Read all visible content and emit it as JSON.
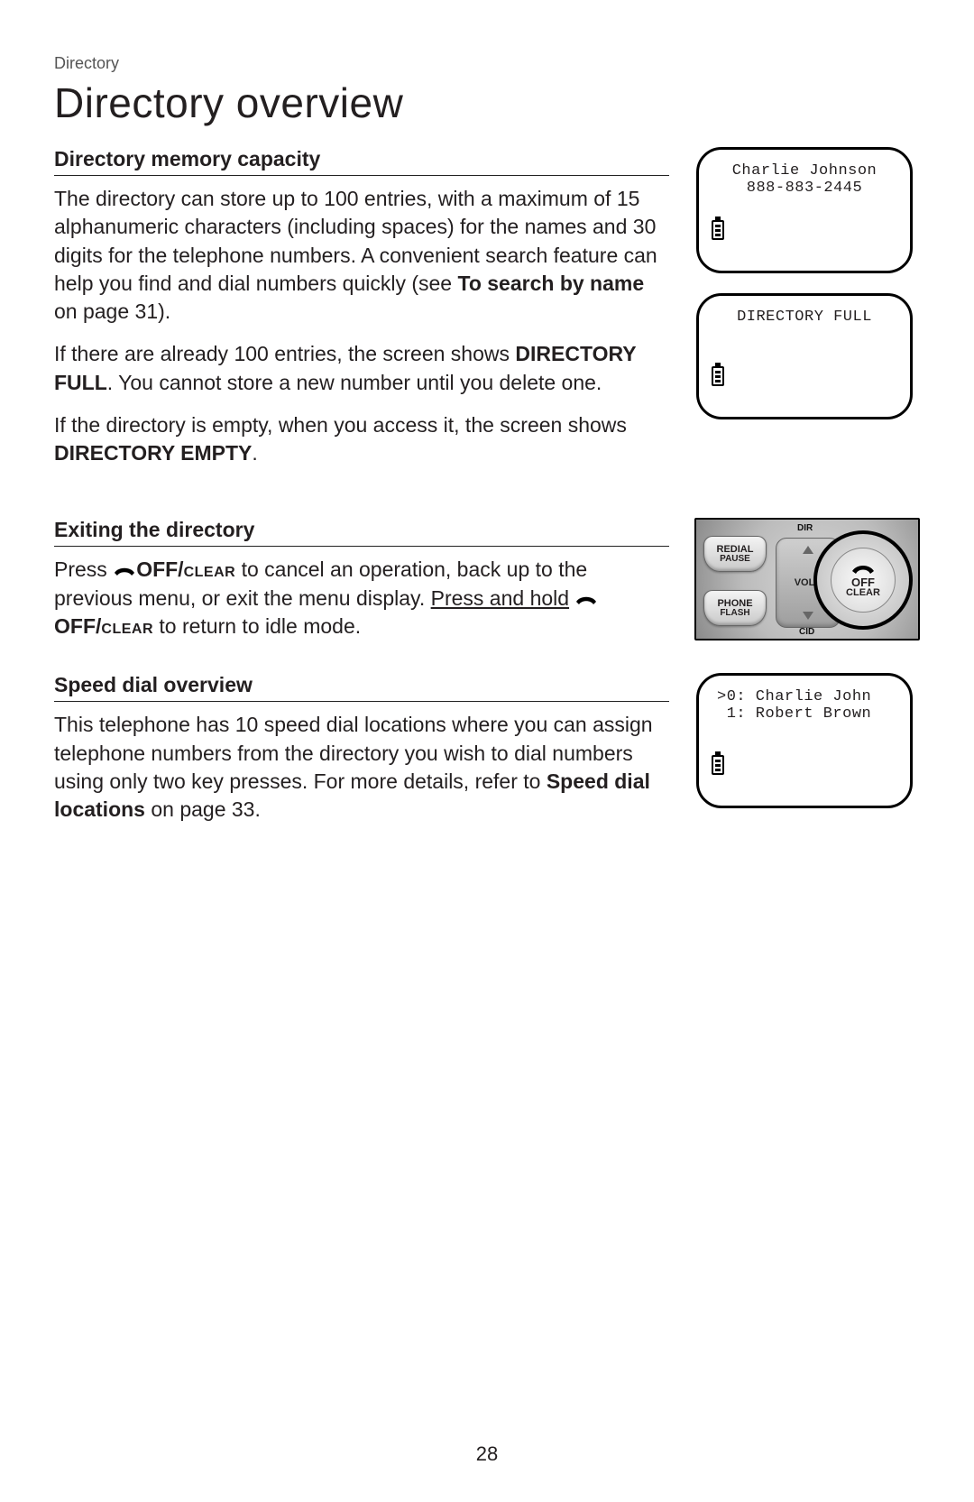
{
  "breadcrumb": "Directory",
  "title": "Directory overview",
  "page_number": "28",
  "sections": {
    "memory": {
      "heading": "Directory memory capacity",
      "p1_a": "The directory can store up to 100 entries, with a maximum of 15 alphanumeric characters (including spaces) for the names and 30 digits for the telephone numbers. A convenient search feature can help you find and dial numbers quickly (see ",
      "p1_bold": "To search by name",
      "p1_b": " on page 31).",
      "p2_a": "If there are already 100 entries, the screen shows ",
      "p2_bold": "DIRECTORY FULL",
      "p2_b": ". You cannot store a new number until you delete one.",
      "p3_a": "If the directory is empty, when you access it, the screen shows ",
      "p3_bold": "DIRECTORY EMPTY",
      "p3_b": "."
    },
    "exiting": {
      "heading": "Exiting the directory",
      "p1_a": "Press ",
      "p1_key1": "OFF/",
      "p1_key1b": "clear",
      "p1_b": " to cancel an operation, back up to the previous menu, or exit the menu display. ",
      "p1_u": "Press and hold",
      "p1_c": " ",
      "p1_key2": "OFF/",
      "p1_key2b": "clear",
      "p1_d": " to return to idle mode."
    },
    "speed": {
      "heading": "Speed dial overview",
      "p1_a": "This telephone has 10 speed dial locations where you can assign telephone numbers from the directory you wish to dial numbers using only two key presses. For more details, refer to ",
      "p1_bold": "Speed dial locations",
      "p1_b": " on page 33."
    }
  },
  "screens": {
    "entry": {
      "line1": "Charlie Johnson",
      "line2": "888-883-2445"
    },
    "full": {
      "line1": "DIRECTORY FULL"
    },
    "speed": {
      "line1": ">0: Charlie John",
      "line2": " 1: Robert Brown"
    }
  },
  "keypad": {
    "dir": "DIR",
    "cid": "CID",
    "redial": "REDIAL",
    "pause": "PAUSE",
    "phone": "PHONE",
    "flash": "FLASH",
    "volume": "VOLU",
    "off": "OFF",
    "clear": "CLEAR"
  }
}
